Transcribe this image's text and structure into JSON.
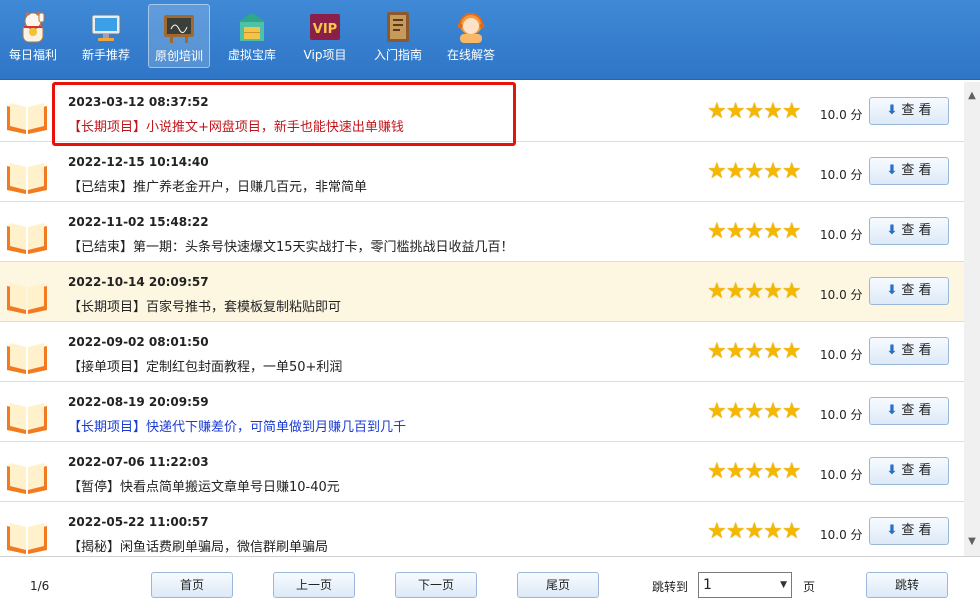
{
  "toolbar": {
    "items": [
      {
        "label": "每日福利",
        "icon": "lucky-cat-icon"
      },
      {
        "label": "新手推荐",
        "icon": "monitor-icon"
      },
      {
        "label": "原创培训",
        "icon": "blackboard-icon"
      },
      {
        "label": "虚拟宝库",
        "icon": "treasure-store-icon"
      },
      {
        "label": "Vip项目",
        "icon": "vip-icon",
        "badge": "VIP"
      },
      {
        "label": "入门指南",
        "icon": "guide-book-icon"
      },
      {
        "label": "在线解答",
        "icon": "support-agent-icon"
      }
    ],
    "active_index": 2
  },
  "list": {
    "rows": [
      {
        "date": "2023-03-12 08:37:52",
        "title": "【长期项目】小说推文+网盘项目，新手也能快速出单赚钱",
        "score": "10.0 分",
        "rating": 5,
        "view": "查 看"
      },
      {
        "date": "2022-12-15 10:14:40",
        "title": "【已结束】推广养老金开户，日赚几百元，非常简单",
        "score": "10.0 分",
        "rating": 5,
        "view": "查 看"
      },
      {
        "date": "2022-11-02 15:48:22",
        "title": "【已结束】第一期：头条号快速爆文15天实战打卡，零门槛挑战日收益几百！",
        "score": "10.0 分",
        "rating": 5,
        "view": "查 看"
      },
      {
        "date": "2022-10-14 20:09:57",
        "title": "【长期项目】百家号推书，套模板复制粘贴即可",
        "score": "10.0 分",
        "rating": 5,
        "view": "查 看"
      },
      {
        "date": "2022-09-02 08:01:50",
        "title": "【接单项目】定制红包封面教程，一单50+利润",
        "score": "10.0 分",
        "rating": 5,
        "view": "查 看"
      },
      {
        "date": "2022-08-19 20:09:59",
        "title": "【长期项目】快递代下赚差价，可简单做到月赚几百到几千",
        "score": "10.0 分",
        "rating": 5,
        "view": "查 看"
      },
      {
        "date": "2022-07-06 11:22:03",
        "title": "【暂停】快看点简单搬运文章单号日赚10-40元",
        "score": "10.0 分",
        "rating": 5,
        "view": "查 看"
      },
      {
        "date": "2022-05-22 11:00:57",
        "title": "【揭秘】闲鱼话费刷单骗局，微信群刷单骗局",
        "score": "10.0 分",
        "rating": 5,
        "view": "查 看"
      }
    ],
    "stars_glyph": "★★★★★"
  },
  "pager": {
    "page_info": "1/6",
    "first": "首页",
    "prev": "上一页",
    "next": "下一页",
    "last": "尾页",
    "jump_label": "跳转到",
    "selected_page": "1",
    "page_unit": "页",
    "go": "跳转"
  },
  "colors": {
    "toolbar_bg": "#3a82d0",
    "highlight_row": "#fdf7e2",
    "red_title": "#c0161b",
    "blue_title": "#1a3bd4",
    "star": "#f5b800",
    "red_box": "#e8120c"
  }
}
